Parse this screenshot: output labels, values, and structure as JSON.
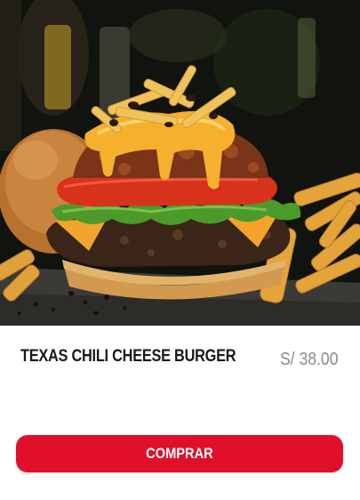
{
  "product": {
    "name": "TEXAS CHILI CHEESE BURGER",
    "price": "S/ 38.00",
    "image_icon": "burger-photo"
  },
  "actions": {
    "buy_label": "COMPRAR"
  },
  "colors": {
    "accent": "#e1102a",
    "price_text": "#8a8a8a",
    "name_text": "#1a1a1a"
  }
}
